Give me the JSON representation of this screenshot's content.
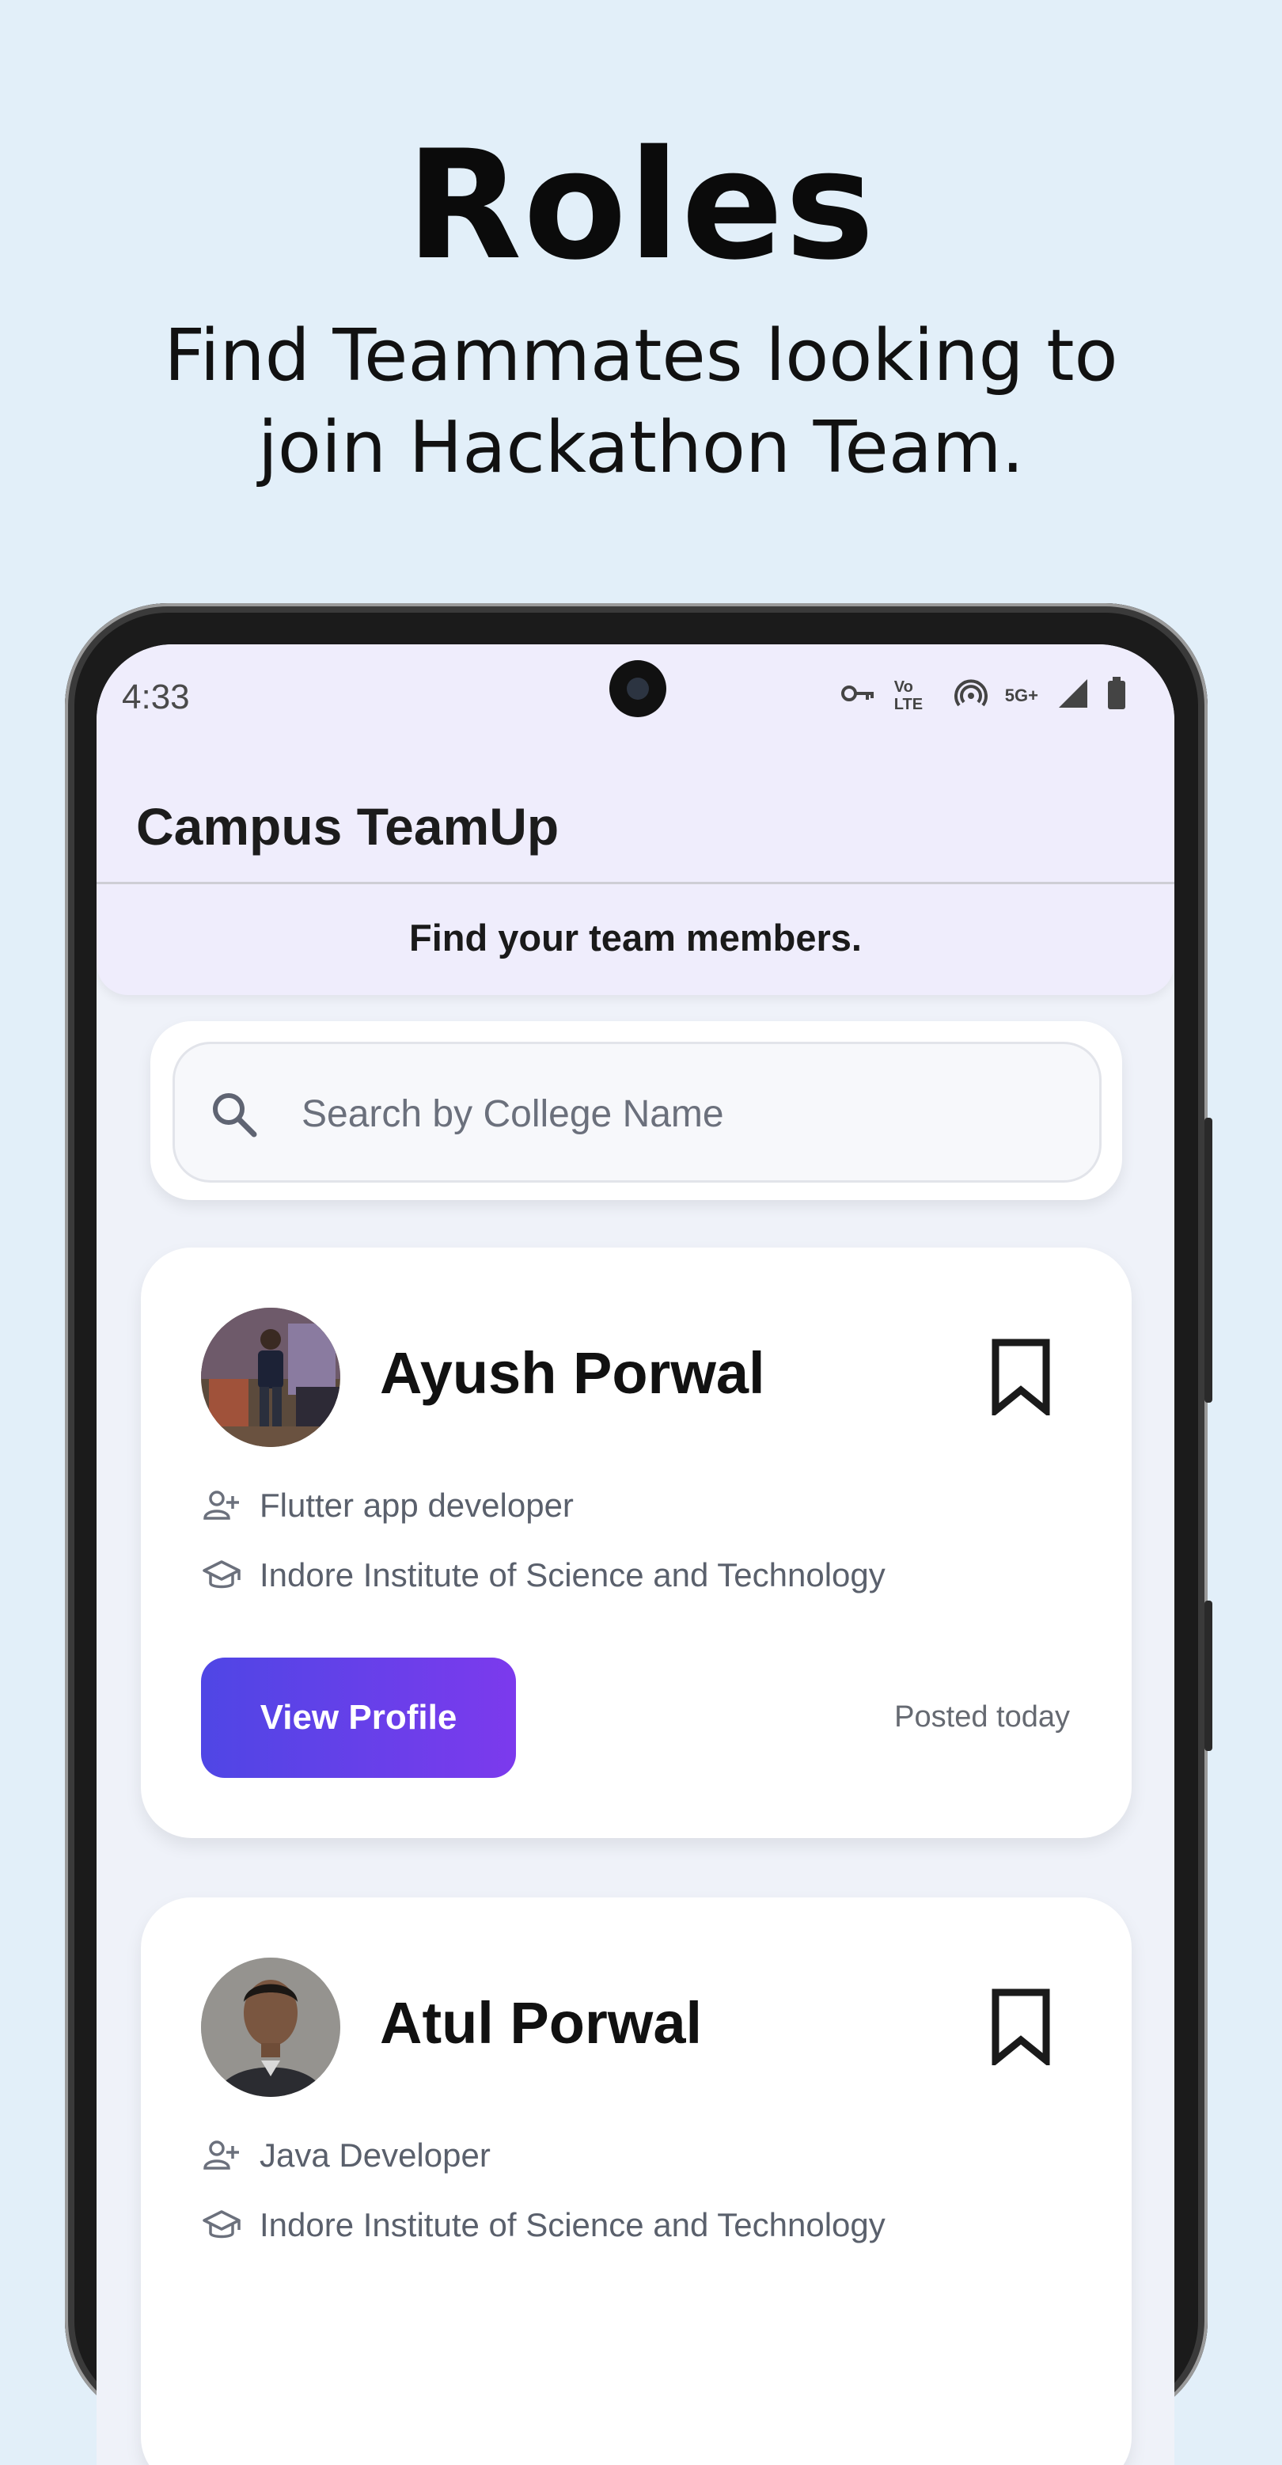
{
  "promo": {
    "title": "Roles",
    "subtitle_line1": "Find Teammates looking to",
    "subtitle_line2": "join Hackathon Team."
  },
  "status_bar": {
    "time": "4:33",
    "icons": [
      "vpn-key-icon",
      "volte-icon",
      "hotspot-icon",
      "5g-plus-icon",
      "signal-icon",
      "battery-icon"
    ],
    "volte_text": "Vo LTE",
    "network_text": "5G+"
  },
  "app_bar": {
    "title": "Campus TeamUp"
  },
  "banner": {
    "text": "Find your team members."
  },
  "search": {
    "placeholder": "Search by College Name",
    "icon": "search-icon"
  },
  "profiles": [
    {
      "name": "Ayush Porwal",
      "role": "Flutter app developer",
      "college": "Indore Institute of Science and Technology",
      "button_label": "View Profile",
      "posted": "Posted today"
    },
    {
      "name": "Atul Porwal",
      "role": "Java Developer",
      "college": "Indore Institute of Science and Technology"
    }
  ],
  "colors": {
    "background": "#e2eff9",
    "app_bar": "#efedfc",
    "button_gradient_start": "#4f46e5",
    "button_gradient_end": "#7c3aed"
  }
}
